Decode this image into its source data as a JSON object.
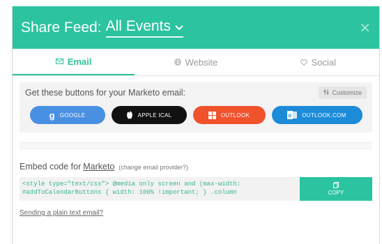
{
  "header": {
    "title_prefix": "Share Feed:",
    "feed_name": "All Events",
    "close_glyph": "✕",
    "color": "#2cc3a0"
  },
  "tabs": [
    {
      "label": "Email",
      "icon": "email-icon",
      "active": true
    },
    {
      "label": "Website",
      "icon": "globe-icon",
      "active": false
    },
    {
      "label": "Social",
      "icon": "heart-icon",
      "active": false
    }
  ],
  "email_section": {
    "label": "Get these buttons for your Marketo email:",
    "customize_label": "Customize",
    "buttons": [
      {
        "label": "GOOGLE",
        "icon": "google-g-icon",
        "color": "#4a90e2"
      },
      {
        "label": "APPLE ICAL",
        "icon": "apple-icon",
        "color": "#111111"
      },
      {
        "label": "OUTLOOK",
        "icon": "windows-icon",
        "color": "#f0522c"
      },
      {
        "label": "OUTLOOK.COM",
        "icon": "outlook-icon",
        "color": "#1c8bd8"
      }
    ]
  },
  "embed": {
    "label": "Embed code for",
    "provider": "Marketo",
    "change_link": "(change email provider?)",
    "code_line1": "<style type=\"text/css\"> @media only screen and (max-width:",
    "code_line2": "#addToCalendarButtons { width: 100% !important; } .column",
    "copy_label": "COPY"
  },
  "plain_text_link": "Sending a plain text email?"
}
